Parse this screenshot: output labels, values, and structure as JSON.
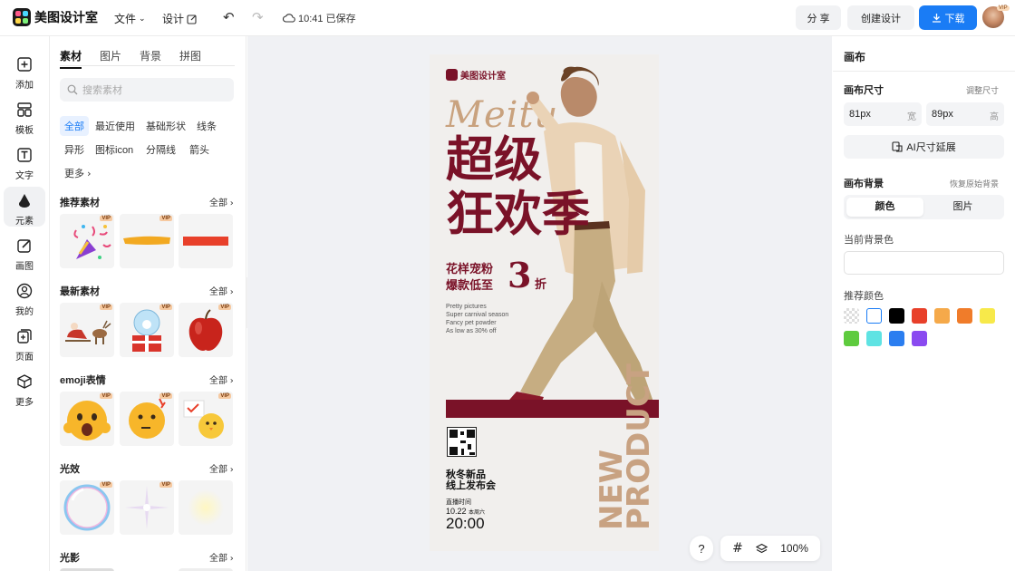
{
  "app": {
    "name": "美图设计室"
  },
  "topbar": {
    "file_label": "文件",
    "design_label": "设计",
    "saved_status": "10:41 已保存",
    "share_label": "分 享",
    "create_label": "创建设计",
    "download_label": "下载"
  },
  "rail": {
    "items": [
      {
        "label": "添加",
        "icon": "plus-square-icon"
      },
      {
        "label": "模板",
        "icon": "template-icon"
      },
      {
        "label": "文字",
        "icon": "text-icon"
      },
      {
        "label": "元素",
        "icon": "elements-icon"
      },
      {
        "label": "画图",
        "icon": "draw-icon"
      },
      {
        "label": "我的",
        "icon": "user-icon"
      },
      {
        "label": "页面",
        "icon": "page-icon"
      },
      {
        "label": "更多",
        "icon": "cube-icon"
      }
    ]
  },
  "panel": {
    "tabs": [
      "素材",
      "图片",
      "背景",
      "拼图"
    ],
    "search_placeholder": "搜索素材",
    "chips": [
      "全部",
      "最近使用",
      "基础形状",
      "线条",
      "异形",
      "图标icon",
      "分隔线",
      "箭头",
      "更多"
    ],
    "vip_badge": "VIP",
    "all_label": "全部",
    "sections": [
      {
        "title": "推荐素材"
      },
      {
        "title": "最新素材"
      },
      {
        "title": "emoji表情"
      },
      {
        "title": "光效"
      },
      {
        "title": "光影"
      }
    ]
  },
  "poster": {
    "brand": "美图设计室",
    "script": "Meitu",
    "headline_1": "超级",
    "headline_2": "狂欢季",
    "offer_1": "花样宠粉",
    "offer_2": "爆款低至",
    "discount": "3",
    "discount_unit": "折",
    "eng_1": "Pretty pictures",
    "eng_2": "Super carnival season",
    "eng_3": "Fancy pet powder",
    "eng_4": "As low as 30% off",
    "event_1": "秋冬新品",
    "event_2": "线上发布会",
    "time_label": "直播时间",
    "date": "10.22",
    "date_note": "本周六",
    "time": "20:00",
    "vertical_1": "NEW",
    "vertical_2": "PRODUCT"
  },
  "canvas_tools": {
    "help": "?",
    "zoom": "100%"
  },
  "right_panel": {
    "title": "画布",
    "size_label": "画布尺寸",
    "adjust_link": "调整尺寸",
    "width_value": "81px",
    "width_unit": "宽",
    "height_value": "89px",
    "height_unit": "高",
    "ai_button": "AI尺寸延展",
    "bg_label": "画布背景",
    "restore_link": "恢复原始背景",
    "seg_color": "颜色",
    "seg_image": "图片",
    "current_bg_label": "当前背景色",
    "recommend_label": "推荐颜色",
    "swatches": [
      "transparent",
      "#ffffff",
      "#000000",
      "#e8402a",
      "#f5a94a",
      "#f07c2a",
      "#f7e94a",
      "#5ecb3e",
      "#5fe3e3",
      "#2b7ef0",
      "#8a4af0"
    ]
  },
  "colors": {
    "accent": "#1a7cf5",
    "poster_red": "#7a1228",
    "poster_tan": "#c8a282"
  }
}
